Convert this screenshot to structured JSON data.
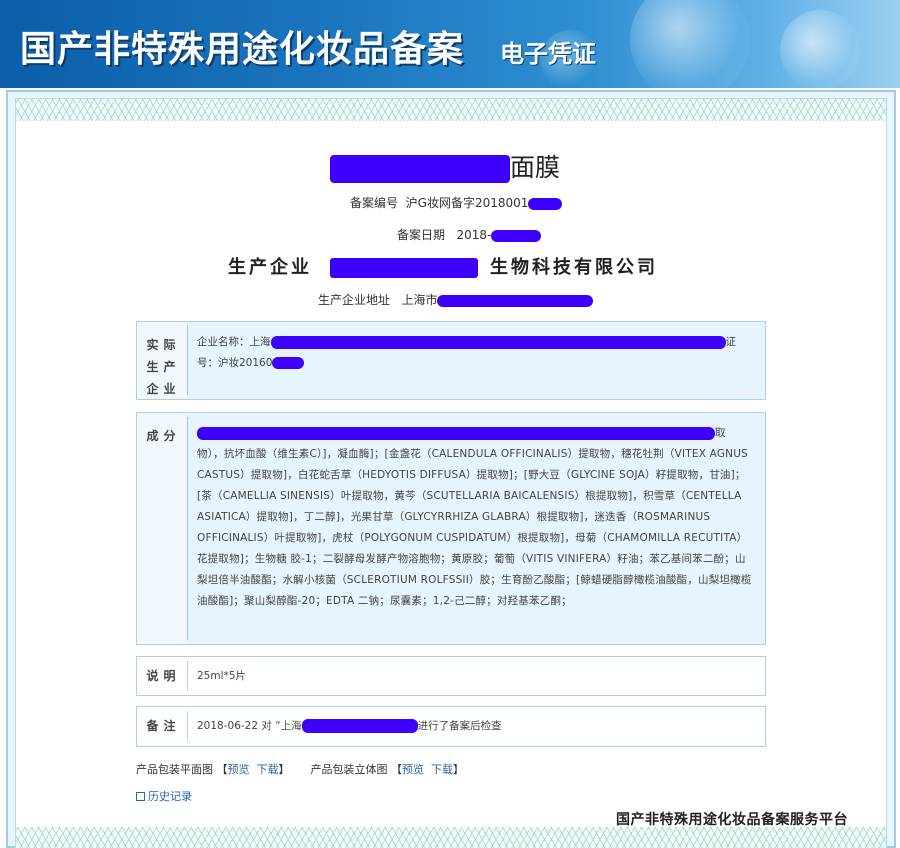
{
  "banner": {
    "title": "国产非特殊用途化妆品备案",
    "subtitle": "电子凭证"
  },
  "product": {
    "name_suffix": "面膜"
  },
  "registration": {
    "number_label": "备案编号",
    "number_value": "沪G妆网备字2018001",
    "date_label": "备案日期",
    "date_value": "2018-"
  },
  "producer": {
    "label": "生产企业",
    "name_suffix": "生物科技有限公司",
    "address_label": "生产企业地址",
    "address_value": "上海市"
  },
  "actual_company": {
    "label": "实际生产企业",
    "name_prefix": "企业名称：上海",
    "tail": "证",
    "license": "号：沪妆20160"
  },
  "ingredients": {
    "label": "成分",
    "tail": "取",
    "text": "物），抗坏血酸（维生素C）]，凝血酶]；[金盏花（CALENDULA OFFICINALIS）提取物，穗花牡荆（VITEX AGNUS CASTUS）提取物]，白花蛇舌草（HEDYOTIS DIFFUSA）提取物]；[野大豆（GLYCINE SOJA）籽提取物，甘油]；[茶（CAMELLIA SINENSIS）叶提取物，黄芩（SCUTELLARIA BAICALENSIS）根提取物]，积雪草（CENTELLA ASIATICA）提取物]，丁二醇]，光果甘草（GLYCYRRHIZA GLABRA）根提取物]，迷迭香（ROSMARINUS OFFICINALIS）叶提取物]，虎杖（POLYGONUM CUSPIDATUM）根提取物]，母菊（CHAMOMILLA RECUTITA）花提取物]；生物糖 胶-1；二裂酵母发酵产物溶胞物；黄原胶；葡萄（VITIS VINIFERA）籽油；苯乙基间苯二酚；山梨坦倍半油酸酯；水解小核菌（SCLEROTIUM ROLFSSII）胶；生育酚乙酸酯；[鲸蜡硬脂醇橄榄油酸酯，山梨坦橄榄油酸酯]；聚山梨醇酯-20；EDTA 二钠；尿囊素；1,2-己二醇；对羟基苯乙酮；"
  },
  "note": {
    "label": "说明",
    "value": "25ml*5片"
  },
  "remark": {
    "label": "备注",
    "prefix": "2018-06-22 对 “上海",
    "suffix": "进行了备案后检查"
  },
  "packaging": {
    "flat_label": "产品包装平面图",
    "flat_preview": "预览",
    "flat_download": "下载",
    "solid_label": "产品包装立体图",
    "solid_preview": "预览",
    "solid_download": "下载",
    "open_bracket": "【",
    "close_bracket": "】"
  },
  "history": {
    "label": "历史记录"
  },
  "footer": {
    "platform": "国产非特殊用途化妆品备案服务平台"
  },
  "colors": {
    "banner": "#1a74bd",
    "redaction": "#3d00ff",
    "link": "#2a64a8",
    "box_border": "#a9d2e8",
    "box_shaded": "#e6f4fd"
  }
}
